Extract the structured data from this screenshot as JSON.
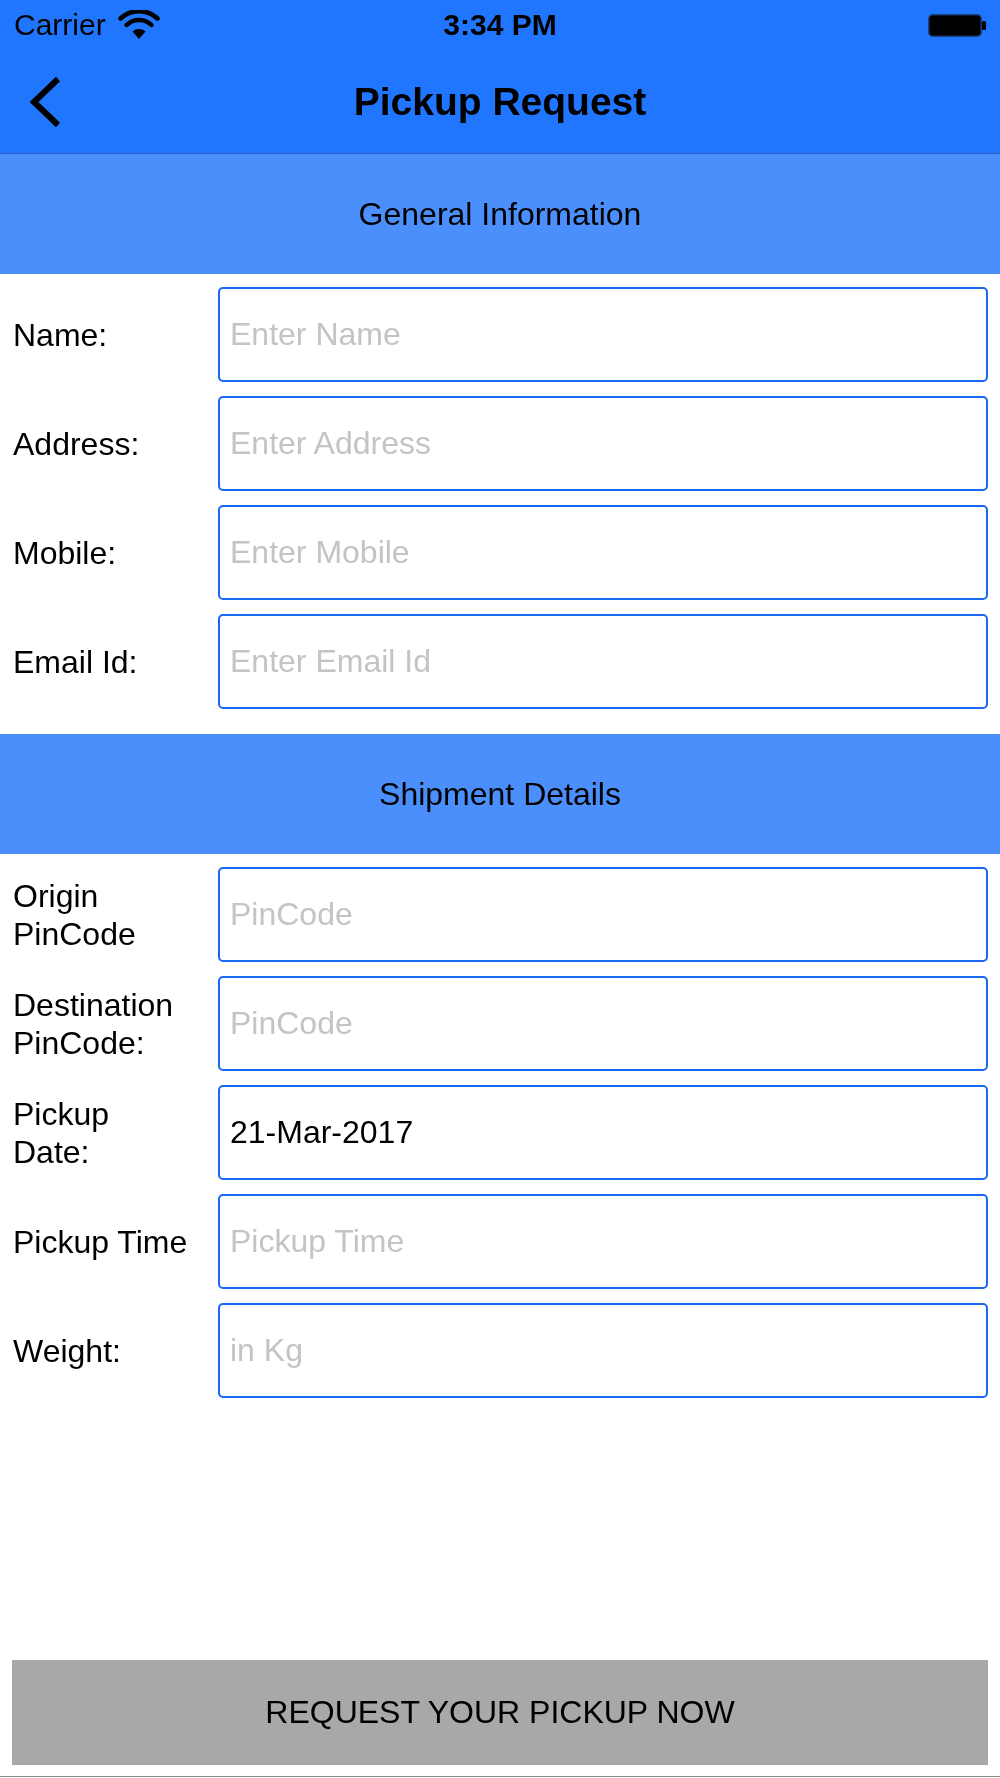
{
  "status_bar": {
    "carrier": "Carrier",
    "time": "3:34 PM"
  },
  "nav_bar": {
    "title": "Pickup Request"
  },
  "sections": [
    {
      "title": "General Information",
      "fields": [
        {
          "label": "Name:",
          "placeholder": "Enter Name"
        },
        {
          "label": "Address:",
          "placeholder": "Enter Address"
        },
        {
          "label": "Mobile:",
          "placeholder": "Enter Mobile"
        },
        {
          "label": "Email Id:",
          "placeholder": "Enter Email Id"
        }
      ]
    },
    {
      "title": "Shipment Details",
      "fields": [
        {
          "label": "Origin PinCode",
          "placeholder": "PinCode"
        },
        {
          "label": "Destination PinCode:",
          "placeholder": "PinCode"
        },
        {
          "label": "Pickup Date:",
          "value": "21-Mar-2017"
        },
        {
          "label": "Pickup Time",
          "placeholder": "Pickup Time"
        },
        {
          "label": "Weight:",
          "placeholder": "in Kg"
        }
      ]
    }
  ],
  "submit_button": {
    "label": "REQUEST YOUR PICKUP NOW"
  }
}
